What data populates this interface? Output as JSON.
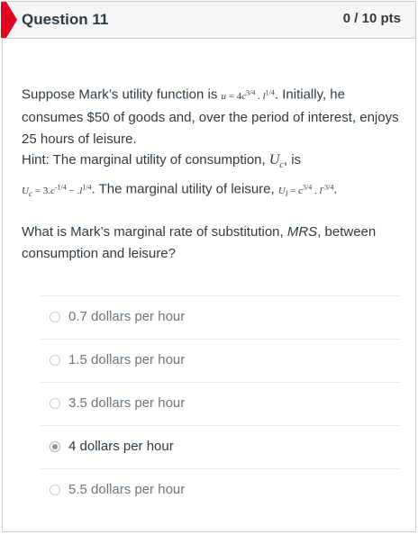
{
  "header": {
    "title": "Question 11",
    "points": "0 / 10 pts",
    "flag_color": "#e0061f"
  },
  "body": {
    "line1_pre": "Suppose Mark’s utility function is ",
    "utility_formula": "u = 4c3/4 . l1/4",
    "line1_post": ". Initially, he consumes $50 of goods and, over the period of interest, enjoys 25 hours of leisure.",
    "hint_pre": "Hint: The marginal utility of consumption, ",
    "hint_symbol_c": "Uc",
    "hint_is": ", is",
    "mu_c_formula": "Uc = 3.c-1/4 − .l1/4",
    "hint_leisure": ". The marginal utility of leisure, ",
    "mu_l_formula": "Ul = c3/4 . l-3/4",
    "hint_end": "."
  },
  "question": {
    "pre": "What is Mark’s marginal rate of substitution, ",
    "mrs": "MRS",
    "post": ", between consumption and leisure?"
  },
  "answers": [
    {
      "label": "0.7 dollars per hour",
      "selected": false
    },
    {
      "label": "1.5 dollars per hour",
      "selected": false
    },
    {
      "label": "3.5 dollars per hour",
      "selected": false
    },
    {
      "label": "4 dollars per hour",
      "selected": true
    },
    {
      "label": "5.5 dollars per hour",
      "selected": false
    }
  ]
}
